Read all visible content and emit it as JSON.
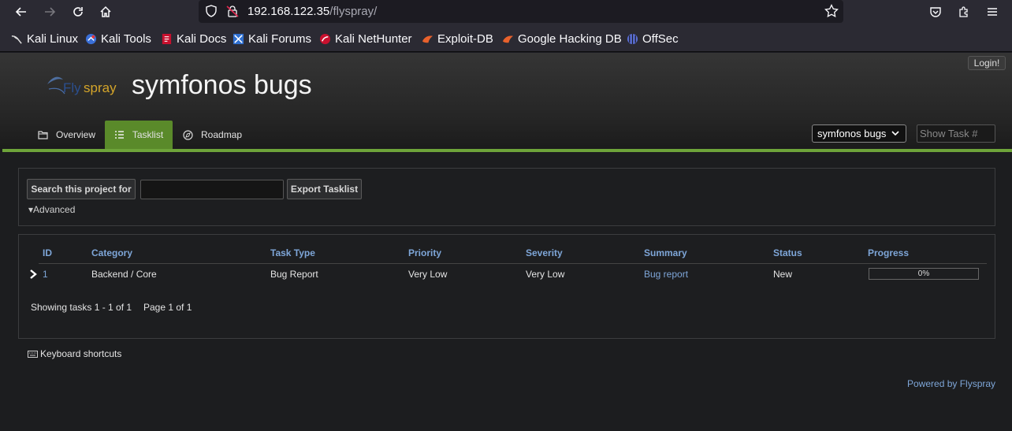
{
  "browser": {
    "url_host": "192.168.122.35",
    "url_path": "/flyspray/",
    "bookmarks": [
      {
        "label": "Kali Linux",
        "icon": "kali-dragon-icon"
      },
      {
        "label": "Kali Tools",
        "icon": "kali-tools-icon"
      },
      {
        "label": "Kali Docs",
        "icon": "kali-docs-icon"
      },
      {
        "label": "Kali Forums",
        "icon": "kali-forums-icon"
      },
      {
        "label": "Kali NetHunter",
        "icon": "kali-nethunter-icon"
      },
      {
        "label": "Exploit-DB",
        "icon": "exploit-db-icon"
      },
      {
        "label": "Google Hacking DB",
        "icon": "ghdb-icon"
      },
      {
        "label": "OffSec",
        "icon": "offsec-icon"
      }
    ]
  },
  "header": {
    "login_label": "Login!",
    "logo_text": "Flyspray",
    "project_title": "symfonos bugs"
  },
  "menu": {
    "tabs": [
      {
        "label": "Overview",
        "active": false
      },
      {
        "label": "Tasklist",
        "active": true
      },
      {
        "label": "Roadmap",
        "active": false
      }
    ],
    "project_select": "symfonos bugs",
    "show_task_placeholder": "Show Task #"
  },
  "search": {
    "label": "Search this project for",
    "value": "",
    "export_label": "Export Tasklist",
    "advanced_label": "▾Advanced"
  },
  "tasklist": {
    "columns": [
      "ID",
      "Category",
      "Task Type",
      "Priority",
      "Severity",
      "Summary",
      "Status",
      "Progress"
    ],
    "rows": [
      {
        "id": "1",
        "category": "Backend / Core",
        "task_type": "Bug Report",
        "priority": "Very Low",
        "severity": "Very Low",
        "summary": "Bug report",
        "status": "New",
        "progress": "0%",
        "progress_value": 0
      }
    ],
    "showing": "Showing tasks 1 - 1 of 1",
    "page": "Page 1 of 1"
  },
  "footer": {
    "shortcuts_label": "Keyboard shortcuts",
    "powered_by": "Powered by Flyspray"
  },
  "colors": {
    "accent_green": "#6ea43a",
    "active_tab": "#5a8a2a",
    "link_blue": "#7ea6d8"
  }
}
